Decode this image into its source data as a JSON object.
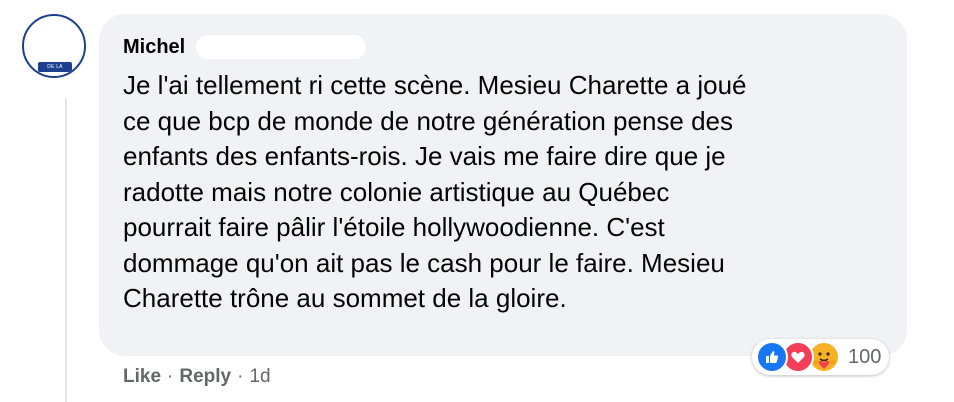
{
  "comment": {
    "author": "Michel",
    "text_lines": [
      "Je l'ai tellement ri cette scène. Mesieu Charette a joué",
      "ce que bcp de monde de notre génération pense des",
      "enfants des enfants-rois. Je vais me faire dire que je",
      "radotte mais notre colonie artistique au Québec",
      "pourrait faire pâlir l'étoile hollywoodienne. C'est",
      "dommage qu'on ait pas le cash pour le faire. Mesieu",
      "Charette trône au sommet de la gloire."
    ],
    "avatar_text": "DE LA GAMTE"
  },
  "reactions": {
    "icons": [
      "like-icon",
      "love-icon",
      "care-icon"
    ],
    "count": "100"
  },
  "actions": {
    "like_label": "Like",
    "separator": "·",
    "reply_label": "Reply",
    "timestamp": "1d"
  },
  "colors": {
    "bubble": "#f0f2f5",
    "like": "#1877f2",
    "love": "#f33e58",
    "care": "#f7b125",
    "secondary_text": "#65676b"
  }
}
